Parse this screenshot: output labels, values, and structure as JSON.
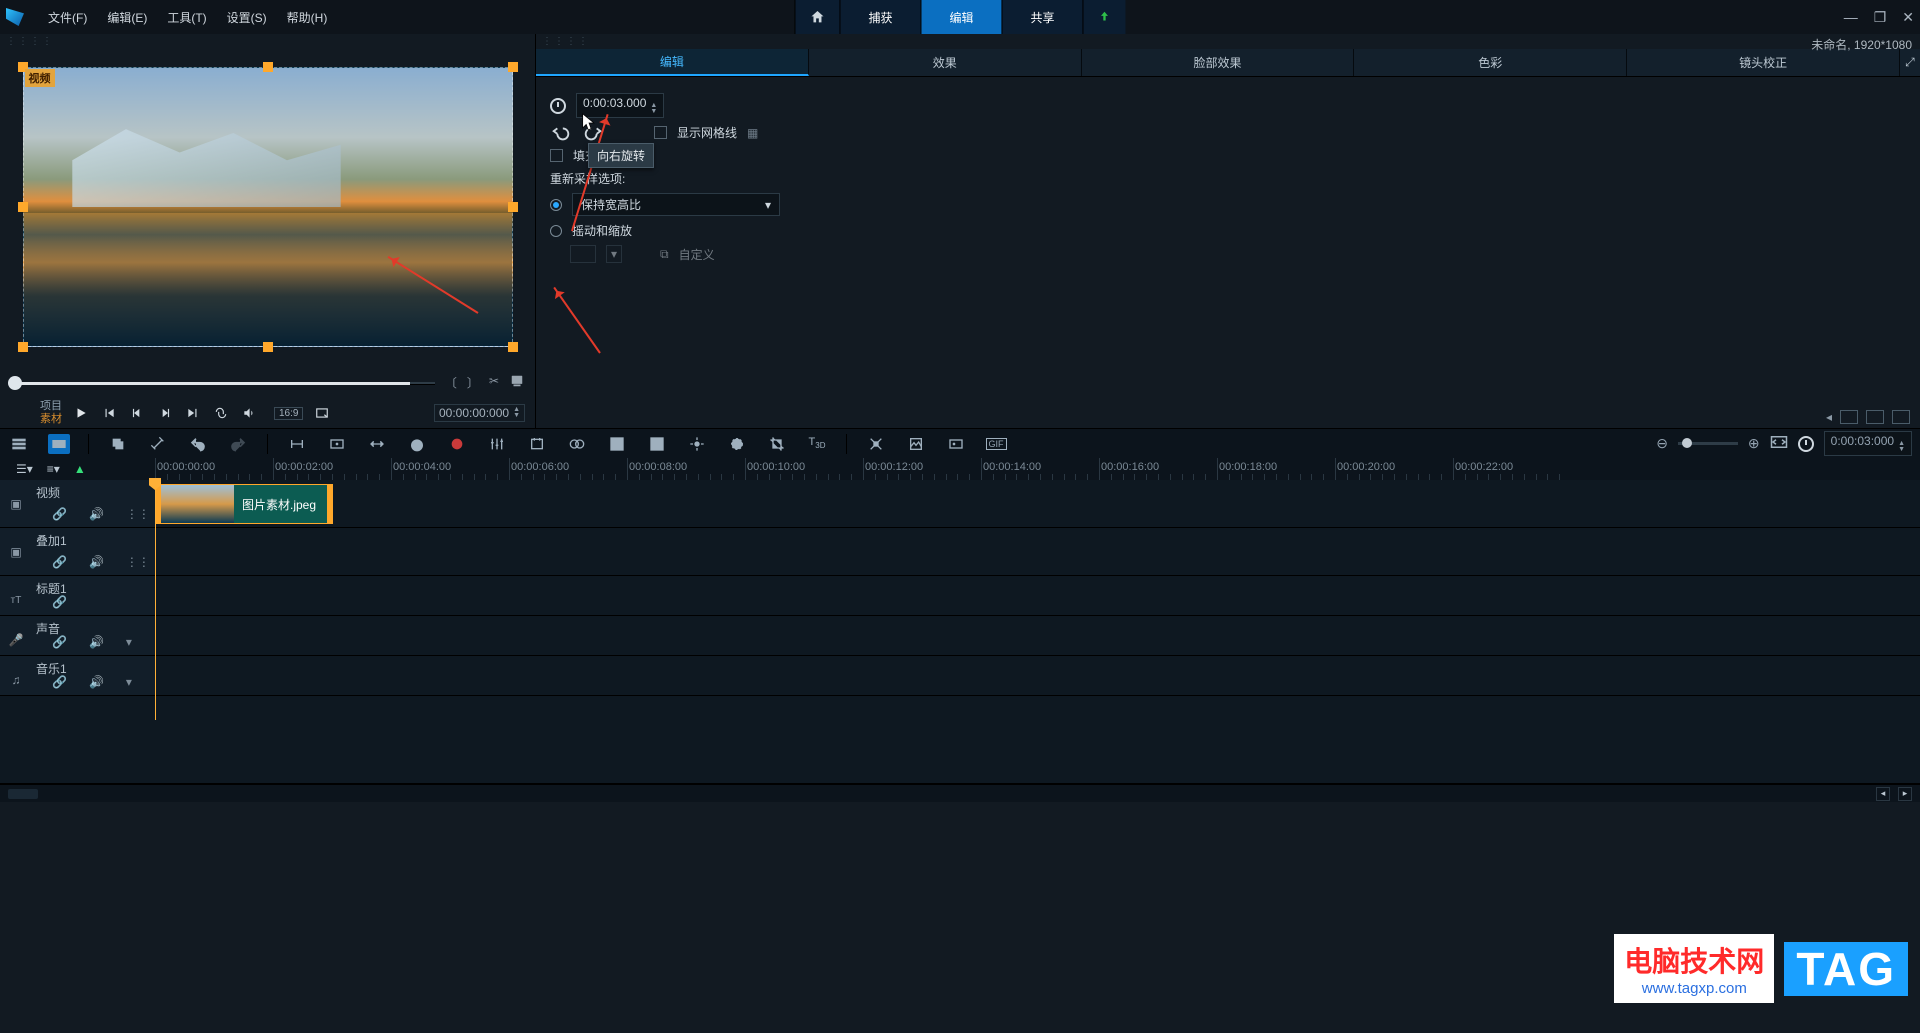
{
  "menu": {
    "file": "文件(F)",
    "edit": "编辑(E)",
    "tools": "工具(T)",
    "settings": "设置(S)",
    "help": "帮助(H)"
  },
  "tabs": {
    "capture": "捕获",
    "edit": "编辑",
    "share": "共享"
  },
  "project_hint": "未命名, 1920*1080",
  "preview": {
    "badge": "视频",
    "project_label": "项目",
    "material_label": "素材",
    "aspect": "16:9",
    "timecode": "00:00:00:000"
  },
  "edit_tabs": {
    "edit": "编辑",
    "effect": "效果",
    "face": "脸部效果",
    "color": "色彩",
    "lens": "镜头校正"
  },
  "edit_panel": {
    "duration": "0:00:03.000",
    "show_grid": "显示网格线",
    "fill_color_label": "填充色",
    "rotate_tooltip": "向右旋转",
    "resample_label": "重新采样选项:",
    "keep_ratio": "保持宽高比",
    "pan_zoom": "摇动和缩放",
    "custom": "自定义"
  },
  "timeline": {
    "time_display": "0:00:03:000",
    "ticks": [
      "00:00:00:00",
      "00:00:02:00",
      "00:00:04:00",
      "00:00:06:00",
      "00:00:08:00",
      "00:00:10:00",
      "00:00:12:00",
      "00:00:14:00",
      "00:00:16:00",
      "00:00:18:00",
      "00:00:20:00",
      "00:00:22:00"
    ],
    "tracks": {
      "video": "视频",
      "overlay": "叠加1",
      "title": "标题1",
      "voice": "声音",
      "music": "音乐1"
    },
    "clip_name": "图片素材.jpeg"
  },
  "watermark": {
    "cn": "电脑技术网",
    "url": "www.tagxp.com",
    "tag": "TAG"
  }
}
